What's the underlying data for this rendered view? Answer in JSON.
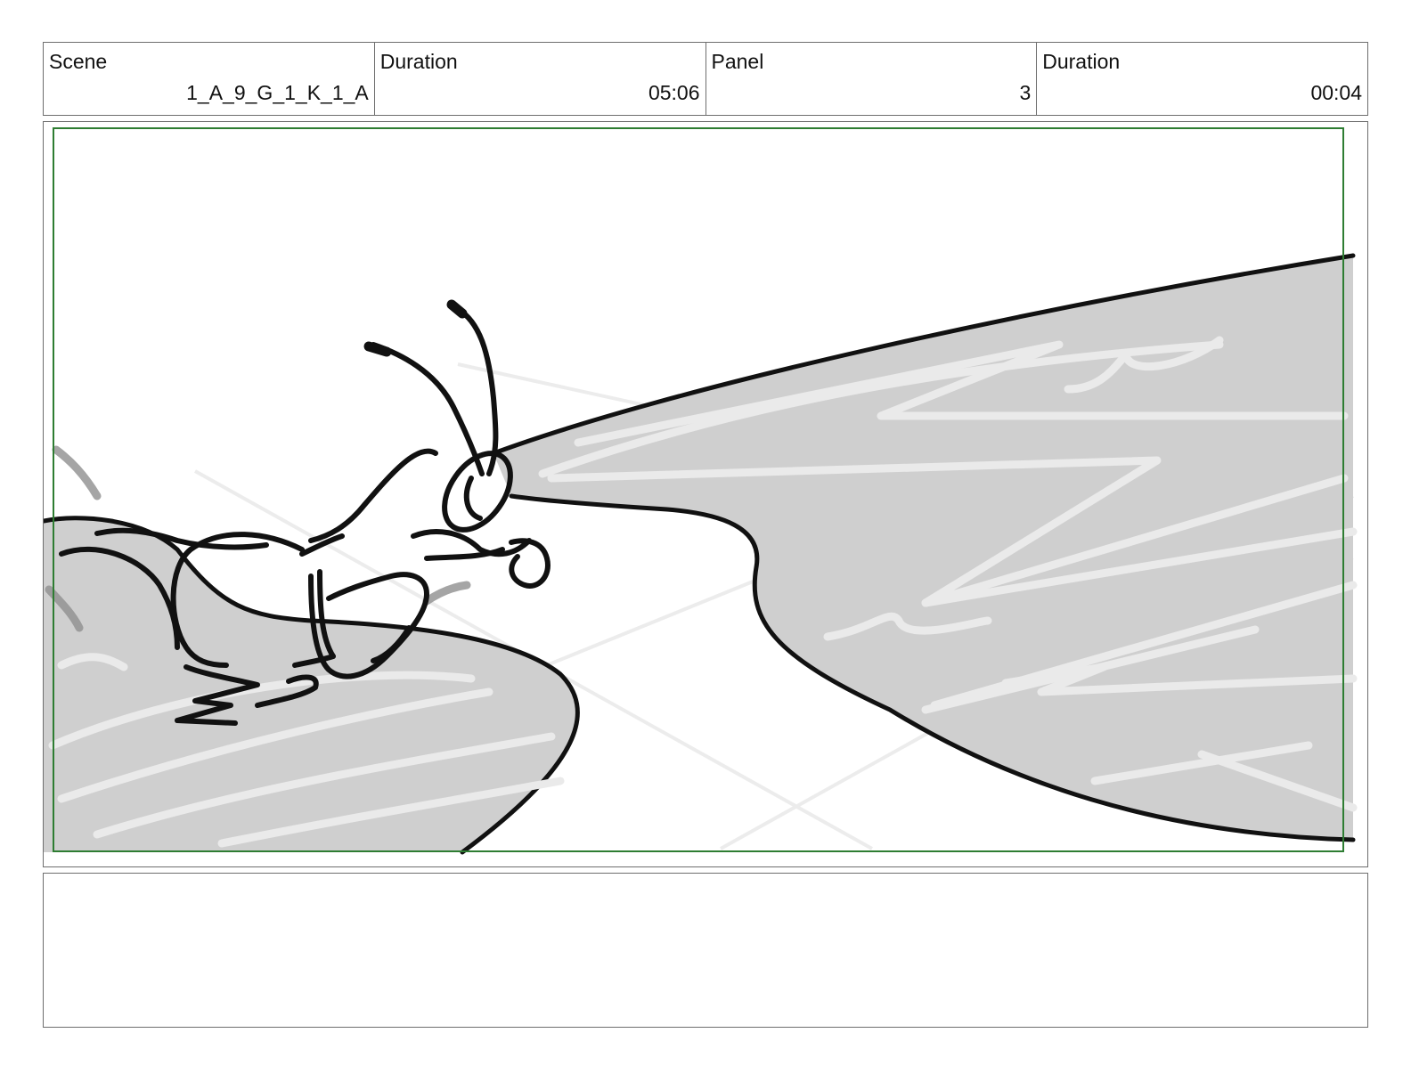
{
  "header": {
    "scene_label": "Scene",
    "scene_value": "1_A_9_G_1_K_1_A",
    "scene_duration_label": "Duration",
    "scene_duration_value": "05:06",
    "panel_label": "Panel",
    "panel_value": "3",
    "panel_duration_label": "Duration",
    "panel_duration_value": "00:04"
  },
  "colors": {
    "safe_frame": "#2e7d32",
    "ink": "#111111",
    "fill_gray": "#cfcfcf",
    "scribble": "#eaeaea",
    "border": "#6e6e6e"
  },
  "notes": {
    "text": ""
  }
}
